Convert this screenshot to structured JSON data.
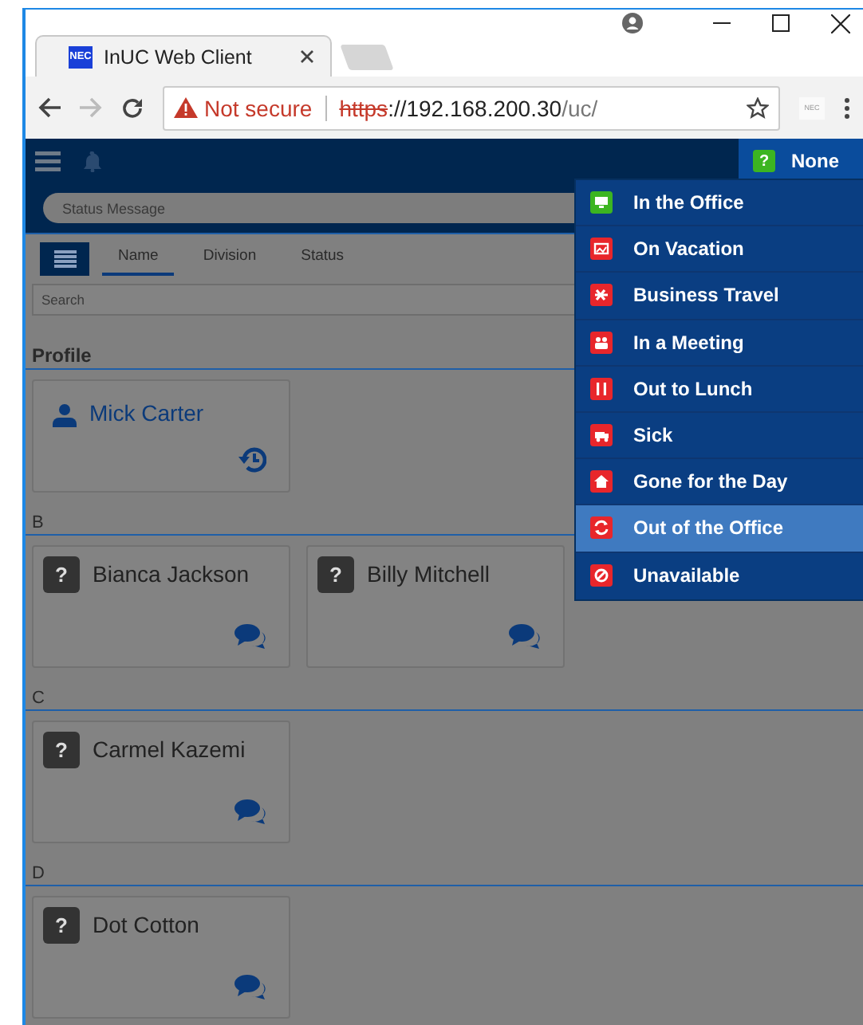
{
  "browser": {
    "tab_title": "InUC Web Client",
    "favicon_text": "NEC",
    "not_secure": "Not secure",
    "url_scheme": "https",
    "url_host": "://192.168.200.30",
    "url_path": "/uc/",
    "extension_text": "NEC"
  },
  "header": {
    "status_glyph": "?",
    "status_label": "None"
  },
  "status_message": {
    "placeholder": "Status Message"
  },
  "sort_tabs": [
    {
      "label": "Name",
      "selected": true
    },
    {
      "label": "Division",
      "selected": false
    },
    {
      "label": "Status",
      "selected": false
    }
  ],
  "search": {
    "placeholder": "Search"
  },
  "groups": [
    {
      "title": "Profile",
      "contacts": [
        {
          "name": "Mick Carter",
          "kind": "self"
        }
      ]
    },
    {
      "title": "B",
      "contacts": [
        {
          "name": "Bianca Jackson",
          "kind": "contact",
          "glyph": "?"
        },
        {
          "name": "Billy Mitchell",
          "kind": "contact",
          "glyph": "?"
        }
      ]
    },
    {
      "title": "C",
      "contacts": [
        {
          "name": "Carmel Kazemi",
          "kind": "contact",
          "glyph": "?"
        }
      ]
    },
    {
      "title": "D",
      "contacts": [
        {
          "name": "Dot Cotton",
          "kind": "contact",
          "glyph": "?"
        }
      ]
    }
  ],
  "status_menu": [
    {
      "label": "In the Office",
      "color": "#3cb521",
      "selected": false
    },
    {
      "label": "On Vacation",
      "color": "#e8262b",
      "selected": false
    },
    {
      "label": "Business Travel",
      "color": "#e8262b",
      "selected": false
    },
    {
      "label": "In a Meeting",
      "color": "#e8262b",
      "selected": false
    },
    {
      "label": "Out to Lunch",
      "color": "#e8262b",
      "selected": false
    },
    {
      "label": "Sick",
      "color": "#e8262b",
      "selected": false
    },
    {
      "label": "Gone for the Day",
      "color": "#e8262b",
      "selected": false
    },
    {
      "label": "Out of the Office",
      "color": "#e8262b",
      "selected": true
    },
    {
      "label": "Unavailable",
      "color": "#e8262b",
      "selected": false
    }
  ]
}
